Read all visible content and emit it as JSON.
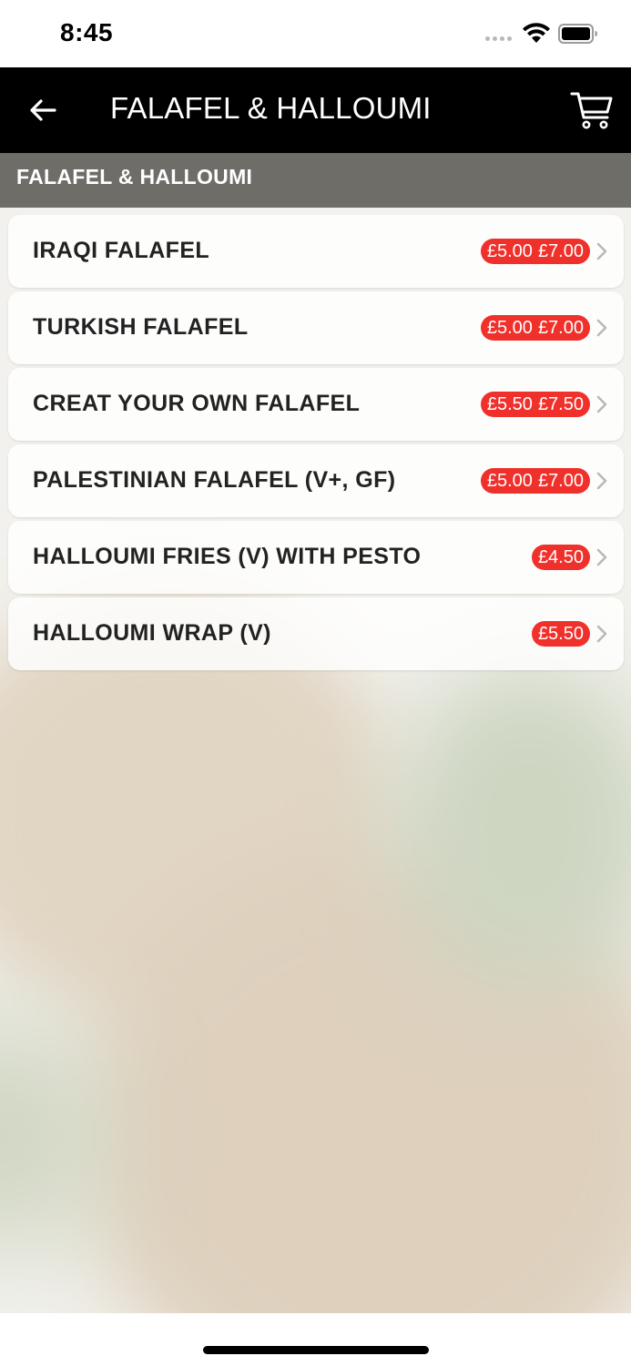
{
  "status_bar": {
    "time": "8:45"
  },
  "nav": {
    "title": "FALAFEL & HALLOUMI",
    "back_icon": "arrow-left-icon",
    "cart_icon": "cart-icon"
  },
  "section": {
    "title": "FALAFEL & HALLOUMI"
  },
  "colors": {
    "nav_background": "#000000",
    "price_badge": "#f0302b",
    "section_header": "#64625c"
  },
  "items": [
    {
      "name": "IRAQI FALAFEL",
      "prices": [
        "£5.00",
        "£7.00"
      ]
    },
    {
      "name": "TURKISH FALAFEL",
      "prices": [
        "£5.00",
        "£7.00"
      ]
    },
    {
      "name": "CREAT YOUR OWN FALAFEL",
      "prices": [
        "£5.50",
        "£7.50"
      ]
    },
    {
      "name": "PALESTINIAN FALAFEL (V+, GF)",
      "prices": [
        "£5.00",
        "£7.00"
      ]
    },
    {
      "name": "HALLOUMI FRIES (V) WITH PESTO",
      "prices": [
        "£4.50"
      ]
    },
    {
      "name": "HALLOUMI WRAP (V)",
      "prices": [
        "£5.50"
      ]
    }
  ]
}
